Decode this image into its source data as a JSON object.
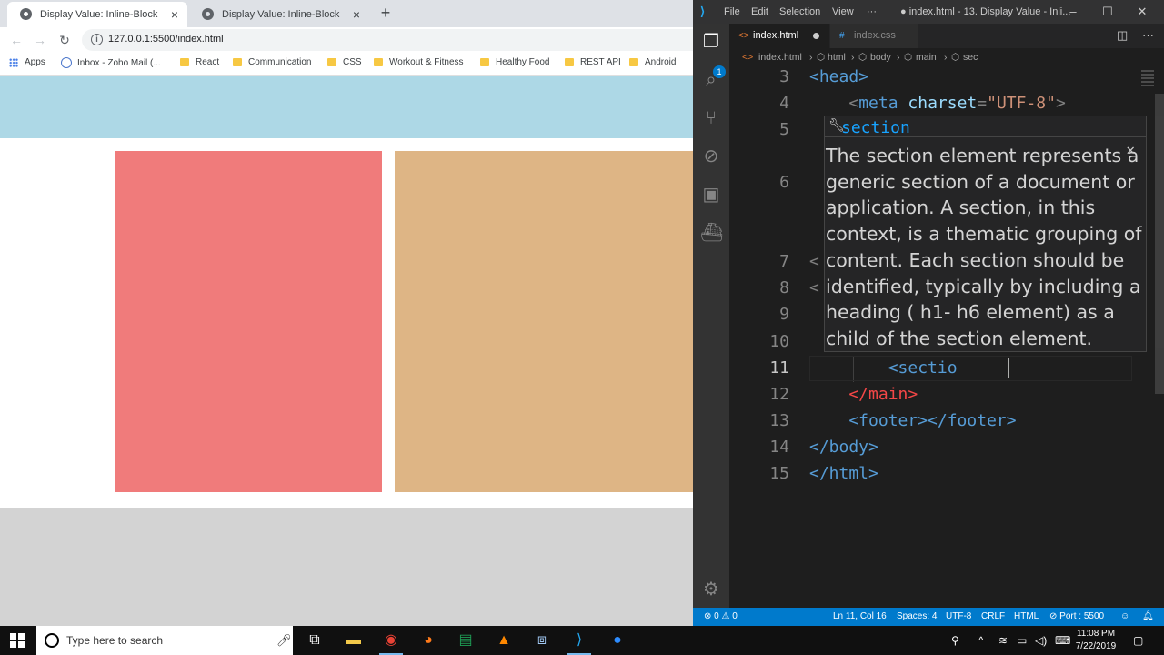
{
  "browser": {
    "tabs": [
      {
        "title": "Display Value: Inline-Block",
        "active": true
      },
      {
        "title": "Display Value: Inline-Block",
        "active": false
      }
    ],
    "url": "127.0.0.1:5500/index.html",
    "bookmarks": [
      {
        "label": "Apps",
        "icon": "apps-grid-icon"
      },
      {
        "label": "Inbox - Zoho Mail (...",
        "icon": "mail-icon"
      },
      {
        "label": "React",
        "icon": "folder-icon"
      },
      {
        "label": "Communication",
        "icon": "folder-icon"
      },
      {
        "label": "CSS",
        "icon": "folder-icon"
      },
      {
        "label": "Workout & Fitness",
        "icon": "folder-icon"
      },
      {
        "label": "Healthy Food",
        "icon": "folder-icon"
      },
      {
        "label": "REST API",
        "icon": "folder-icon"
      },
      {
        "label": "Android",
        "icon": "folder-icon"
      }
    ],
    "page_colors": {
      "header": "#add8e6",
      "box1": "#f07b7b",
      "box2": "#deb585",
      "footer": "#d3d3d3"
    }
  },
  "vscode": {
    "menu": [
      "File",
      "Edit",
      "Selection",
      "View",
      "···"
    ],
    "window_title": "● index.html - 13. Display Value - Inli...",
    "tabs": [
      {
        "label": "index.html",
        "active": true,
        "dirty": true
      },
      {
        "label": "index.css",
        "active": false
      }
    ],
    "breadcrumb": [
      "index.html",
      "html",
      "body",
      "main",
      "sec"
    ],
    "lines": [
      {
        "no": "3",
        "text": "<head>"
      },
      {
        "no": "4",
        "text": "    <meta charset=\"UTF-8\">"
      },
      {
        "no": "5",
        "text": ""
      },
      {
        "no": "6",
        "text": ""
      },
      {
        "no": "7",
        "text": "<"
      },
      {
        "no": "8",
        "text": "<"
      },
      {
        "no": "9",
        "text": ""
      },
      {
        "no": "10",
        "text": ""
      },
      {
        "no": "11",
        "text": "        <sectio"
      },
      {
        "no": "12",
        "text": "    </main>"
      },
      {
        "no": "13",
        "text": "    <footer></footer>"
      },
      {
        "no": "14",
        "text": "</body>"
      },
      {
        "no": "15",
        "text": "</html>"
      }
    ],
    "suggestion": {
      "label": "section",
      "doc": "The section element represents a generic section of a document or application. A section, in this context, is a thematic grouping of content. Each section should be identified, typically by including a heading ( h1- h6 element) as a child of the section element."
    },
    "status": {
      "errors": "0",
      "warnings": "0",
      "position": "Ln 11, Col 16",
      "spaces": "Spaces: 4",
      "encoding": "UTF-8",
      "eol": "CRLF",
      "language": "HTML",
      "port": "Port : 5500"
    }
  },
  "taskbar": {
    "search_placeholder": "Type here to search",
    "time": "11:08 PM",
    "date": "7/22/2019"
  }
}
